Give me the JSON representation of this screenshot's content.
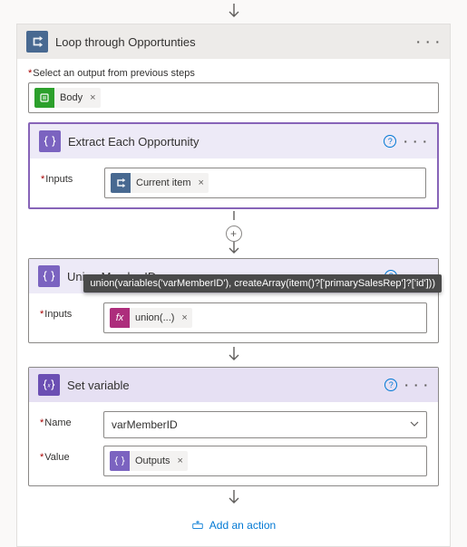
{
  "loop": {
    "title": "Loop through Opportunties",
    "selectLabel": "Select an output from previous steps",
    "bodyToken": "Body"
  },
  "extract": {
    "title": "Extract Each Opportunity",
    "inputsLabel": "Inputs",
    "currentItemToken": "Current item"
  },
  "union": {
    "title": "Union MemberIDs",
    "inputsLabel": "Inputs",
    "fxToken": "union(...)",
    "tooltip": "union(variables('varMemberID'), createArray(item()?['primarySalesRep']?['id']))"
  },
  "setvar": {
    "title": "Set variable",
    "nameLabel": "Name",
    "nameValue": "varMemberID",
    "valueLabel": "Value",
    "outputsToken": "Outputs"
  },
  "addAction": "Add an action",
  "fxGlyph": "fx",
  "removeGlyph": "×",
  "plusGlyph": "+",
  "helpGlyph": "?",
  "ellipsis": "· · ·"
}
